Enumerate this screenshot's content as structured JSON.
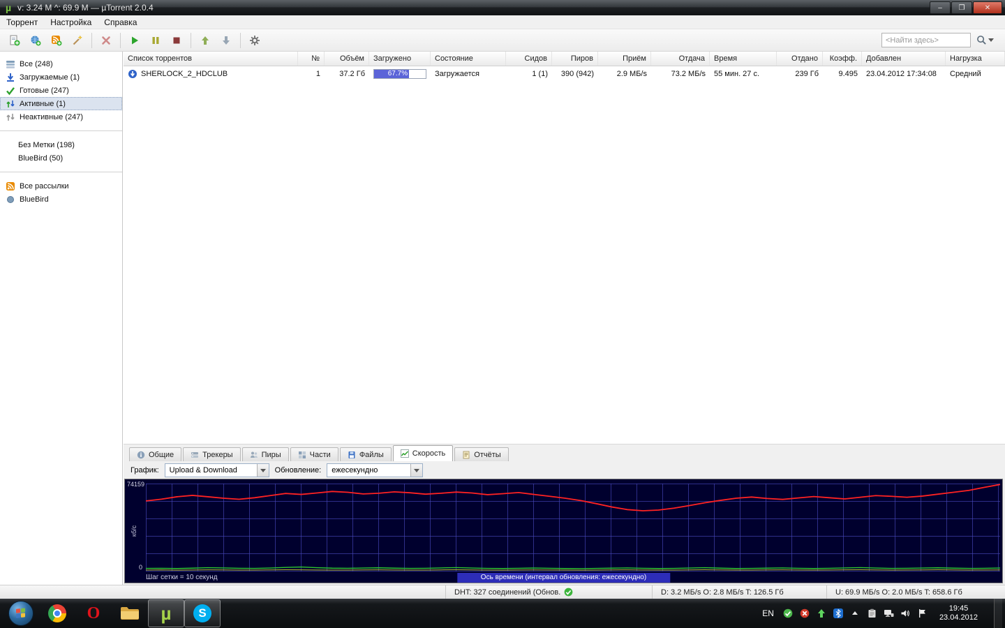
{
  "window": {
    "title": "v: 3.24 M  ^: 69.9 M — µTorrent 2.0.4",
    "minimize": "–",
    "restore": "❐",
    "close": "✕"
  },
  "icons": {
    "mu": "µ",
    "opera": "O",
    "skype": "S"
  },
  "menu": {
    "items": [
      "Торрент",
      "Настройка",
      "Справка"
    ]
  },
  "toolbar": {
    "search_placeholder": "<Найти здесь>"
  },
  "sidebar": {
    "items": [
      {
        "label": "Все (248)"
      },
      {
        "label": "Загружаемые (1)"
      },
      {
        "label": "Готовые (247)"
      },
      {
        "label": "Активные (1)"
      },
      {
        "label": "Неактивные (247)"
      },
      {
        "label": "Без Метки (198)"
      },
      {
        "label": "BlueBird (50)"
      },
      {
        "label": "Все рассылки"
      },
      {
        "label": "BlueBird"
      }
    ]
  },
  "table": {
    "columns": [
      "Список торрентов",
      "№",
      "Объём",
      "Загружено",
      "Состояние",
      "Сидов",
      "Пиров",
      "Приём",
      "Отдача",
      "Время",
      "Отдано",
      "Коэфф.",
      "Добавлен",
      "Нагрузка"
    ],
    "rows": [
      {
        "cells": [
          "SHERLOCK_2_HDCLUB",
          "1",
          "37.2 Гб",
          "67.7%",
          "Загружается",
          "1 (1)",
          "390 (942)",
          "2.9 МБ/s",
          "73.2 МБ/s",
          "55 мин. 27 с.",
          "239 Гб",
          "9.495",
          "23.04.2012 17:34:08",
          "Средний"
        ],
        "progress_percent": 67.7
      }
    ]
  },
  "tabs": {
    "items": [
      "Общие",
      "Трекеры",
      "Пиры",
      "Части",
      "Файлы",
      "Скорость",
      "Отчёты"
    ]
  },
  "speed_panel": {
    "graph_label": "График:",
    "graph_value": "Upload & Download",
    "update_label": "Обновление:",
    "update_value": "ежесекундно",
    "y_max": "74159",
    "y_zero": "0",
    "y_axis_label": "кб/с",
    "footer_left": "Шаг сетки = 10 секунд",
    "footer_center": "Ось времени (интервал обновления: ежесекундно)"
  },
  "chart_data": {
    "type": "line",
    "title": "",
    "xlabel": "Ось времени (интервал обновления: ежесекундно)",
    "ylabel": "кб/с",
    "ylim": [
      0,
      74159
    ],
    "grid": true,
    "series": [
      {
        "name": "upload-speed",
        "color": "#ff2222",
        "width": 1.8,
        "values": [
          59500,
          61000,
          63000,
          64200,
          63000,
          61800,
          60900,
          62200,
          64000,
          65800,
          65000,
          66200,
          67500,
          66800,
          65400,
          66000,
          67200,
          66400,
          65200,
          66000,
          67000,
          66200,
          64800,
          65600,
          66600,
          65000,
          63400,
          61800,
          59800,
          57200,
          54400,
          52200,
          51200,
          51800,
          53400,
          55600,
          58000,
          60000,
          61800,
          62800,
          61600,
          60800,
          62000,
          63200,
          62200,
          61200,
          62600,
          64000,
          63400,
          62600,
          63600,
          65200,
          66800,
          68400,
          71000,
          73400
        ]
      },
      {
        "name": "download-speed",
        "color": "#2ec82e",
        "width": 1.4,
        "values": [
          2600,
          2700,
          2500,
          2800,
          3200,
          3000,
          2700,
          2600,
          2900,
          3400,
          3800,
          3200,
          2800,
          2700,
          2900,
          3100,
          2800,
          2600,
          2700,
          3000,
          3300,
          2900,
          2600,
          2500,
          2700,
          2900,
          2700,
          2500,
          2400,
          2600,
          2800,
          3000,
          2700,
          2500,
          2600,
          2900,
          3200,
          2800,
          2500,
          2600,
          2800,
          3000,
          2700,
          2500,
          2700,
          3000,
          3300,
          2900,
          2600,
          2700,
          2900,
          3100,
          2800,
          2600,
          2700,
          2900
        ]
      },
      {
        "name": "average-speed",
        "color": "#b8b832",
        "width": 1,
        "values": [
          1200,
          1300,
          1100,
          1250,
          1400,
          1300,
          1150,
          1200,
          1350,
          1500,
          1400,
          1250,
          1150,
          1200,
          1300,
          1400,
          1250,
          1150,
          1200,
          1350,
          1450,
          1300,
          1150,
          1100,
          1250,
          1350,
          1250,
          1150,
          1100,
          1200,
          1300,
          1400,
          1250,
          1150,
          1200,
          1350,
          1450,
          1300,
          1150,
          1200,
          1300,
          1400,
          1250,
          1150,
          1250,
          1400,
          1500,
          1350,
          1200,
          1250,
          1350,
          1450,
          1300,
          1200,
          1250,
          1350
        ]
      }
    ]
  },
  "statusbar": {
    "dht": "DHT: 327 соединений  (Обнов.",
    "down": "D: 3.2 МБ/s  O: 2.8 МБ/s  T: 126.5 Гб",
    "up": "U: 69.9 МБ/s  O: 2.0 МБ/s  T: 658.6 Гб"
  },
  "taskbar": {
    "language": "EN",
    "time": "19:45",
    "date": "23.04.2012"
  }
}
